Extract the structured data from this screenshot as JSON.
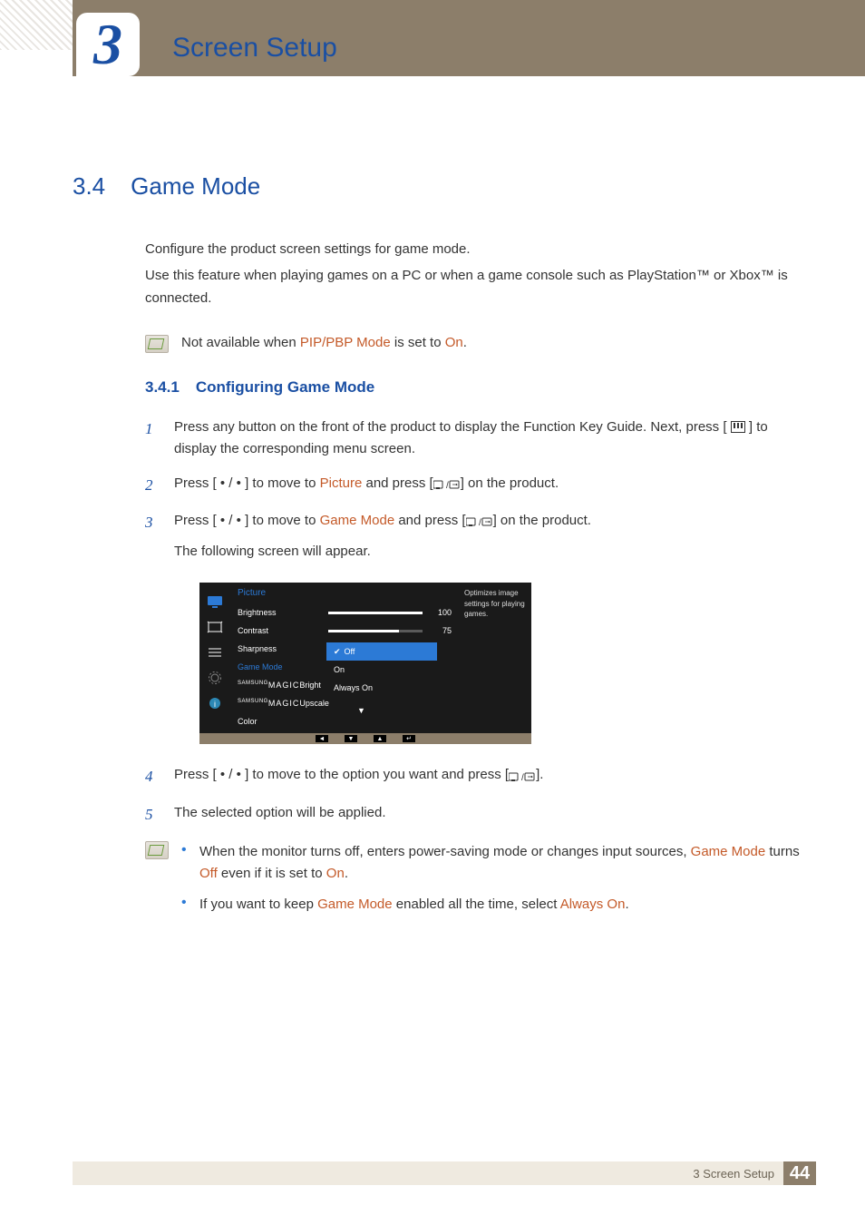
{
  "chapter": {
    "number": "3",
    "title": "Screen Setup"
  },
  "section": {
    "number": "3.4",
    "title": "Game Mode"
  },
  "intro": {
    "p1": "Configure the product screen settings for game mode.",
    "p2": "Use this feature when playing games on a PC or when a game console such as PlayStation™ or Xbox™ is connected."
  },
  "top_note": {
    "pre": "Not available when ",
    "t1": "PIP/PBP Mode",
    "mid": " is set to ",
    "t2": "On",
    "post": "."
  },
  "subsection": {
    "number": "3.4.1",
    "title": "Configuring Game Mode"
  },
  "steps": {
    "s1": {
      "num": "1",
      "pre": "Press any button on the front of the product to display the Function Key Guide. Next, press [",
      "post": "] to display the corresponding menu screen."
    },
    "s2": {
      "num": "2",
      "pre": "Press [ ",
      "dots": "•",
      "slash": " / ",
      "mid": " ] to move to ",
      "term": "Picture",
      "mid2": " and press [",
      "post": "] on the product."
    },
    "s3": {
      "num": "3",
      "pre": "Press [ ",
      "dots": "•",
      "slash": " / ",
      "mid": " ] to move to ",
      "term": "Game Mode",
      "mid2": " and press [",
      "post": "] on the product.",
      "tail": "The following screen will appear."
    },
    "s4": {
      "num": "4",
      "pre": "Press [ ",
      "dots": "•",
      "slash": " / ",
      "mid": " ] to move to the option you want and press [",
      "post": "]."
    },
    "s5": {
      "num": "5",
      "text": "The selected option will be applied."
    }
  },
  "osd": {
    "title": "Picture",
    "items": {
      "brightness": {
        "label": "Brightness",
        "value": "100",
        "fill": 100
      },
      "contrast": {
        "label": "Contrast",
        "value": "75",
        "fill": 75
      },
      "sharpness": {
        "label": "Sharpness"
      },
      "gamemode": {
        "label": "Game Mode"
      },
      "magicbright": {
        "pre": "SAMSUNG",
        "main": "MAGIC",
        "suf": "Bright"
      },
      "magicupscale": {
        "pre": "SAMSUNG",
        "main": "MAGIC",
        "suf": "Upscale"
      },
      "color": {
        "label": "Color"
      }
    },
    "options": {
      "off": "Off",
      "on": "On",
      "always": "Always On"
    },
    "desc": "Optimizes image settings for playing games.",
    "check": "✔",
    "chev": "▼"
  },
  "notes": {
    "n1": {
      "pre": "When the monitor turns off, enters power-saving mode or changes input sources, ",
      "t1": "Game Mode",
      "mid": " turns ",
      "t2": "Off",
      "mid2": " even if it is set to ",
      "t3": "On",
      "post": "."
    },
    "n2": {
      "pre": "If you want to keep ",
      "t1": "Game Mode",
      "mid": " enabled all the time, select ",
      "t2": "Always On",
      "post": "."
    }
  },
  "footer": {
    "chapter_ref": "3 Screen Setup",
    "page": "44"
  }
}
